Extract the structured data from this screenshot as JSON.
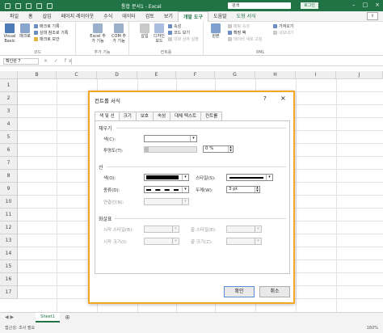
{
  "window": {
    "title": "통합 문서1  -  Excel",
    "search": "검색",
    "login": "로그인"
  },
  "ribbon_tabs": [
    "파일",
    "홈",
    "삽입",
    "페이지 레이아웃",
    "수식",
    "데이터",
    "검토",
    "보기",
    "개발 도구",
    "도움말",
    "도형 서식"
  ],
  "ribbon": {
    "code": {
      "visual_basic": "Visual Basic",
      "macro": "매크로",
      "record": "매크로 기록",
      "relative": "상대 참조로 기록",
      "security": "매크로 보안",
      "label": "코드"
    },
    "addins": {
      "excel_addins": "Excel 추가 기능",
      "com_addins": "COM 추가 기능",
      "label": "추가 기능"
    },
    "controls": {
      "insert": "삽입",
      "design_mode": "디자인 모드",
      "properties": "속성",
      "view_code": "코드 보기",
      "run_dialog": "대화 상자 실행",
      "label": "컨트롤"
    },
    "xml": {
      "source": "원본",
      "map_props": "매핑 속성",
      "expansion": "확장 팩",
      "refresh": "데이터 새로 고침",
      "import": "가져오기",
      "export": "내보내기",
      "label": "XML"
    }
  },
  "formula_bar": {
    "name_box": "확인란 7",
    "fx": "×  ✓  fx"
  },
  "columns": [
    "B",
    "C",
    "D",
    "E",
    "F",
    "G",
    "H",
    "I",
    "J"
  ],
  "rows": [
    "1",
    "2",
    "3",
    "4",
    "5",
    "6",
    "7",
    "8",
    "9",
    "10",
    "11",
    "12",
    "13",
    "14",
    "15",
    "16",
    "17"
  ],
  "dialog": {
    "title": "컨트롤 서식",
    "help": "?",
    "close": "×",
    "tabs": [
      "색 및 선",
      "크기",
      "보호",
      "속성",
      "대체 텍스트",
      "컨트롤"
    ],
    "fill_section": "채우기",
    "fill_color_label": "색(C):",
    "transparency_label": "투명도(T):",
    "transparency_value": "0 %",
    "line_section": "선",
    "line_color_label": "색(O):",
    "dash_label": "종류(D):",
    "connector_label": "연결선(N):",
    "style_label": "스타일(S):",
    "weight_label": "두께(W):",
    "weight_value": "3 pt",
    "arrow_section": "화살표",
    "begin_style_label": "시작 스타일(B):",
    "begin_size_label": "시작 크기(I):",
    "end_style_label": "끝 스타일(E):",
    "end_size_label": "끝 크기(Z):",
    "ok": "확인",
    "cancel": "취소"
  },
  "sheet": {
    "tab": "Sheet1",
    "status": "접근성: 조사 필요",
    "zoom": "160%"
  },
  "colors": {
    "excel_green": "#217346",
    "dialog_highlight": "#f5a623"
  }
}
